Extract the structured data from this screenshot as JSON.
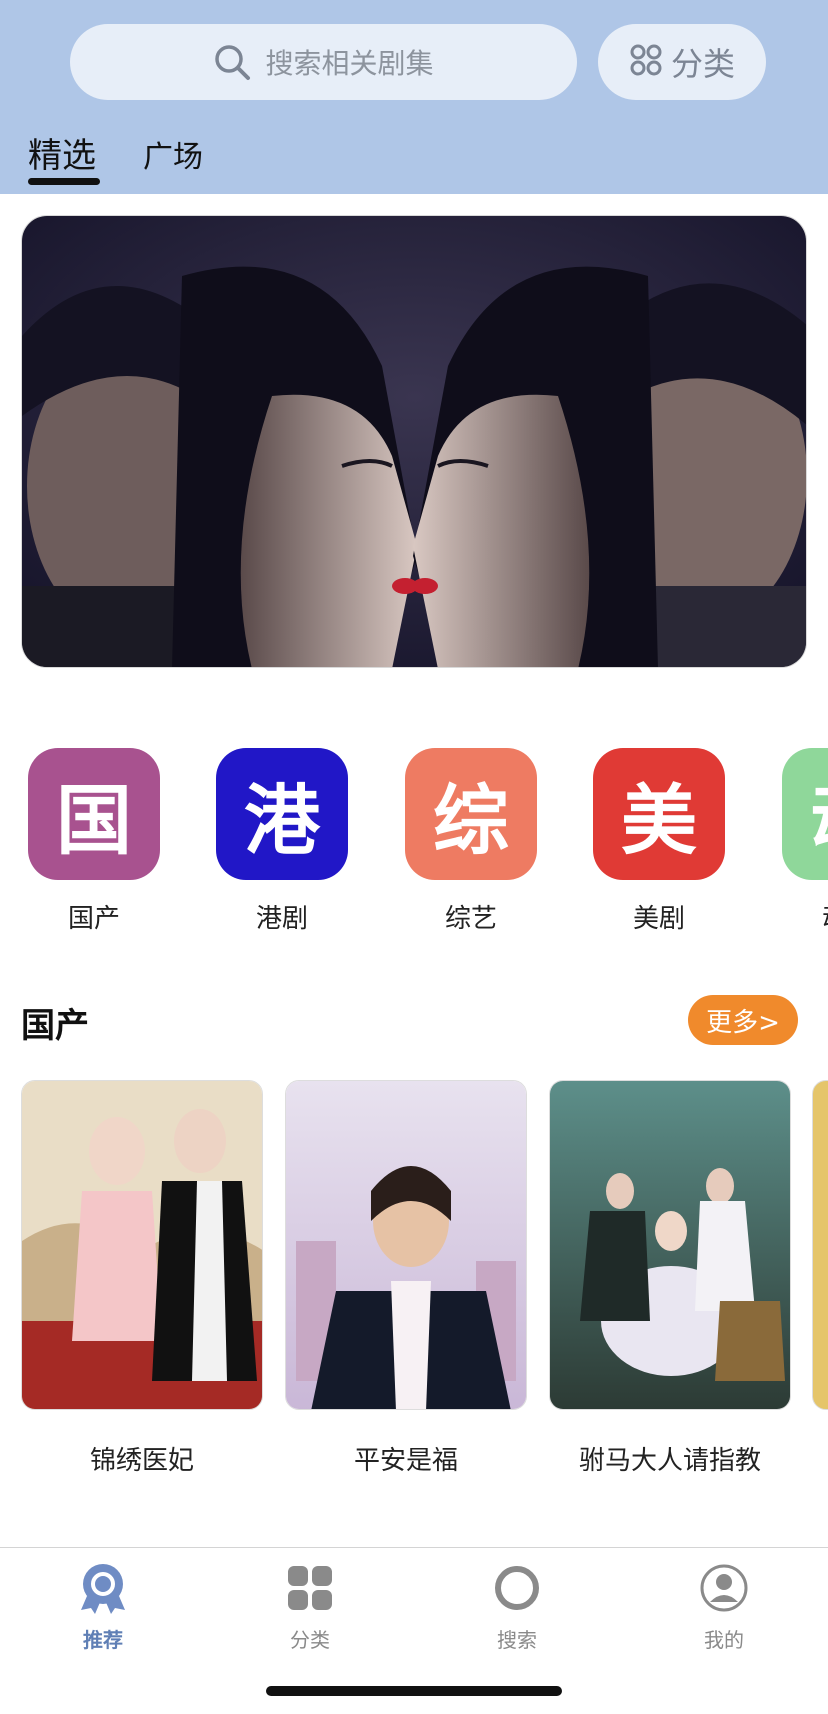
{
  "search": {
    "placeholder": "搜索相关剧集",
    "icon": "search-icon"
  },
  "category_button": {
    "label": "分类",
    "icon": "grid-icon"
  },
  "tabs": [
    {
      "label": "精选",
      "active": true
    },
    {
      "label": "广场",
      "active": false
    }
  ],
  "banner": {
    "alt": "featured-drama-banner"
  },
  "categories": [
    {
      "glyph": "国",
      "label": "国产",
      "color": "#a8528f"
    },
    {
      "glyph": "港",
      "label": "港剧",
      "color": "#2117c7"
    },
    {
      "glyph": "综",
      "label": "综艺",
      "color": "#ee7b62"
    },
    {
      "glyph": "美",
      "label": "美剧",
      "color": "#e03a35"
    },
    {
      "glyph": "动",
      "label": "动漫",
      "color": "#8fd79a"
    }
  ],
  "section": {
    "title": "国产",
    "more_label": "更多>",
    "items": [
      {
        "title": "锦绣医妃",
        "poster_text": "锦绣医妃"
      },
      {
        "title": "平安是福",
        "poster_text": "平安是福"
      },
      {
        "title": "驸马大人请指教",
        "poster_text": "驸马大人请指教"
      }
    ]
  },
  "tabbar": [
    {
      "label": "推荐",
      "icon": "recommend-icon",
      "active": true
    },
    {
      "label": "分类",
      "icon": "category-icon",
      "active": false
    },
    {
      "label": "搜索",
      "icon": "search-icon",
      "active": false
    },
    {
      "label": "我的",
      "icon": "profile-icon",
      "active": false
    }
  ],
  "colors": {
    "header_bg": "#afc6e7",
    "accent": "#5f7fb5",
    "more_button": "#f08a2c"
  }
}
